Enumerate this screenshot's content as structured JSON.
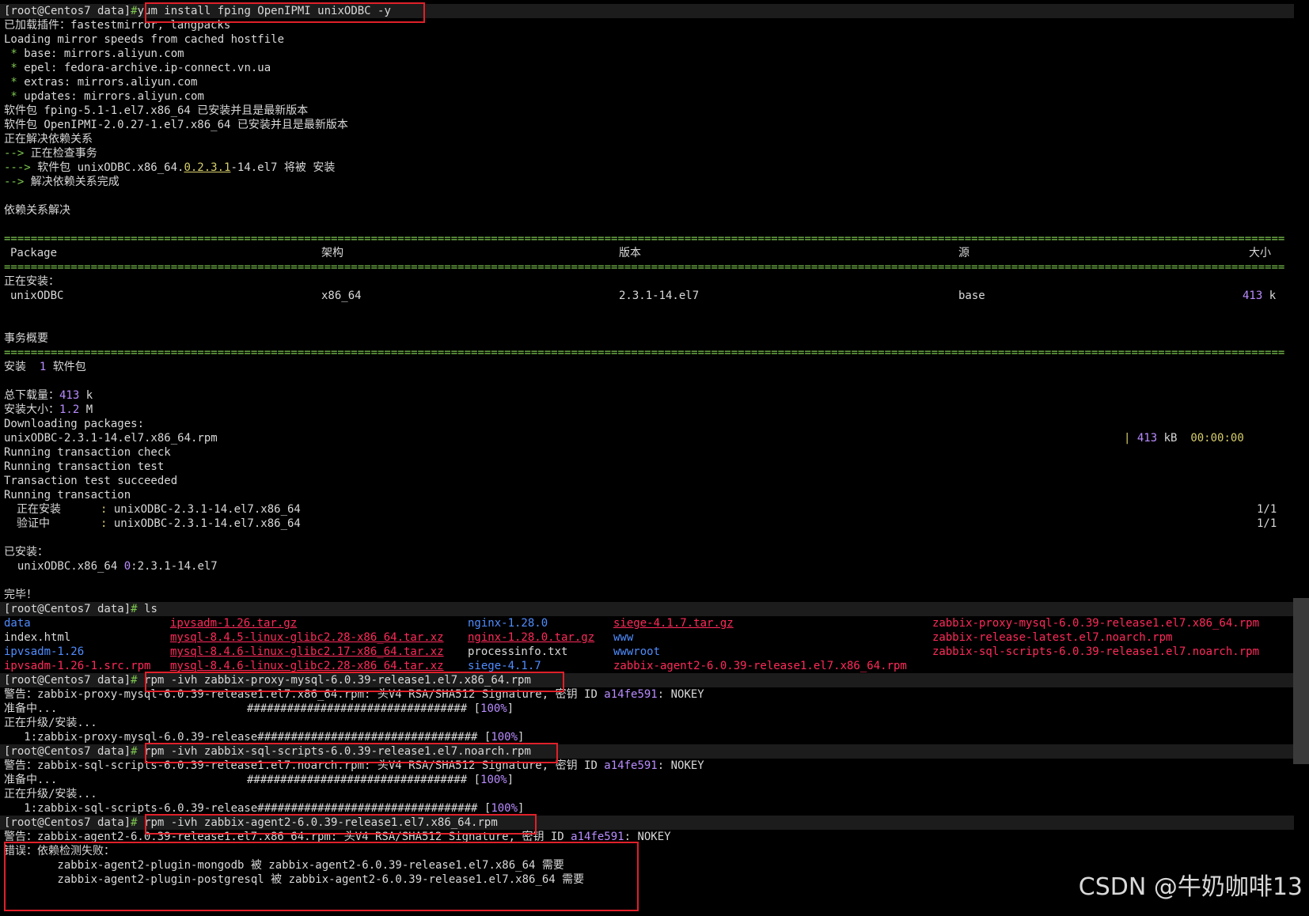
{
  "prompt": "[root@Centos7 data]",
  "hash": "#",
  "cmd1": "yum install fping OpenIPMI unixODBC -y",
  "yum_lines": {
    "plugins": "已加载插件：fastestmirror, langpacks",
    "loading": "Loading mirror speeds from cached hostfile",
    "base": "base: mirrors.aliyun.com",
    "epel": "epel: fedora-archive.ip-connect.vn.ua",
    "extras": "extras: mirrors.aliyun.com",
    "updates": "updates: mirrors.aliyun.com",
    "fping": "软件包 fping-5.1-1.el7.x86_64 已安装并且是最新版本",
    "openipmi": "软件包 OpenIPMI-2.0.27-1.el7.x86_64 已安装并且是最新版本",
    "resolving": "正在解决依赖关系",
    "checking": "正在检查事务",
    "pkg_prefix": "软件包 unixODBC.x86_64.",
    "pkg_version": "0.2.3.1",
    "pkg_suffix": "-14.el7 将被 安装",
    "done_resolving": "解决依赖关系完成",
    "resolved": "依赖关系解决"
  },
  "table": {
    "headers": [
      "Package",
      "架构",
      "版本",
      "源",
      "大小"
    ],
    "installing_label": "正在安装：",
    "row": {
      "package": "unixODBC",
      "arch": "x86_64",
      "version": "2.3.1-14.el7",
      "repo": "base",
      "size_num": "413",
      "size_unit": "k"
    }
  },
  "summary": {
    "title": "事务概要",
    "install_label": "安装",
    "install_count": "1",
    "install_unit": "软件包",
    "total_download_label": "总下载量：",
    "total_download_num": "413",
    "total_download_unit": "k",
    "installed_size_label": "安装大小：",
    "installed_size_num": "1.2",
    "installed_size_unit": "M",
    "downloading": "Downloading packages:",
    "rpm_file": "unixODBC-2.3.1-14.el7.x86_64.rpm",
    "dl_size": "413",
    "dl_unit": "kB",
    "dl_time": "00:00:00",
    "running_check": "Running transaction check",
    "running_test": "Running transaction test",
    "test_ok": "Transaction test succeeded",
    "running": "Running transaction",
    "installing_step": "正在安装",
    "verifying_step": "验证中",
    "step_pkg": "unixODBC-2.3.1-14.el7.x86_64",
    "step_progress": "1/1",
    "installed_label": "已安装：",
    "installed_pkg_prefix": "unixODBC.x86_64 ",
    "installed_epoch": "0",
    "installed_pkg_suffix": ":2.3.1-14.el7",
    "complete": "完毕！"
  },
  "cmd2": "ls",
  "ls_col1": [
    "data",
    "index.html",
    "ipvsadm-1.26",
    "ipvsadm-1.26-1.src.rpm"
  ],
  "ls_col2": [
    "ipvsadm-1.26.tar.gz",
    "mysql-8.4.5-linux-glibc2.28-x86_64.tar.xz",
    "mysql-8.4.6-linux-glibc2.17-x86_64.tar.xz",
    "mysql-8.4.6-linux-glibc2.28-x86_64.tar.xz"
  ],
  "ls_col3": [
    "nginx-1.28.0",
    "nginx-1.28.0.tar.gz",
    "processinfo.txt",
    "siege-4.1.7"
  ],
  "ls_col4": [
    "siege-4.1.7.tar.gz",
    "www",
    "wwwroot",
    "zabbix-agent2-6.0.39-release1.el7.x86_64.rpm"
  ],
  "ls_col5": [
    "zabbix-proxy-mysql-6.0.39-release1.el7.x86_64.rpm",
    "zabbix-release-latest.el7.noarch.rpm",
    "zabbix-sql-scripts-6.0.39-release1.el7.noarch.rpm"
  ],
  "rpm1": {
    "cmd": "rpm -ivh zabbix-proxy-mysql-6.0.39-release1.el7.x86_64.rpm",
    "warn_prefix": "警告：zabbix-proxy-mysql-6.0.39-release1.el7.x86_64.rpm: 头V4 RSA/SHA512 Signature, 密钥 ID ",
    "key": "a14fe591",
    "warn_suffix": ": NOKEY",
    "preparing": "准备中...",
    "bar1": "################################# [",
    "pct": "100%",
    "bar_end": "]",
    "upgrading": "正在升级/安装...",
    "bar2_prefix": "   1:zabbix-proxy-mysql-6.0.39-release",
    "bar2_hashes": "################################# [",
    "bar2_pct": "100%"
  },
  "rpm2": {
    "cmd": "rpm -ivh zabbix-sql-scripts-6.0.39-release1.el7.noarch.rpm",
    "warn_prefix": "警告：zabbix-sql-scripts-6.0.39-release1.el7.noarch.rpm: 头V4 RSA/SHA512 Signature, 密钥 ID ",
    "key": "a14fe591",
    "warn_suffix": ": NOKEY",
    "preparing": "准备中...",
    "bar1": "################################# [",
    "pct": "100%",
    "bar_end": "]",
    "upgrading": "正在升级/安装...",
    "bar2_prefix": "   1:zabbix-sql-scripts-6.0.39-release",
    "bar2_hashes": "################################# [",
    "bar2_pct": "100%"
  },
  "rpm3": {
    "cmd": "rpm -ivh zabbix-agent2-6.0.39-release1.el7.x86_64.rpm",
    "warn_prefix": "警告：zabbix-agent2-6.0.39-release1.el7.x86_64.rpm: 头V4 RSA/SHA512 Signature, 密钥 ID ",
    "key": "a14fe591",
    "warn_suffix": ": NOKEY",
    "error": "错误：依赖检测失败：",
    "dep1": "        zabbix-agent2-plugin-mongodb 被 zabbix-agent2-6.0.39-release1.el7.x86_64 需要",
    "dep2": "        zabbix-agent2-plugin-postgresql 被 zabbix-agent2-6.0.39-release1.el7.x86_64 需要"
  },
  "watermark": "CSDN @牛奶咖啡13",
  "colors": {
    "highlight_box": "#e0202a",
    "green": "#7ec850",
    "purple": "#b98cff",
    "pink": "#ff4f8a"
  }
}
